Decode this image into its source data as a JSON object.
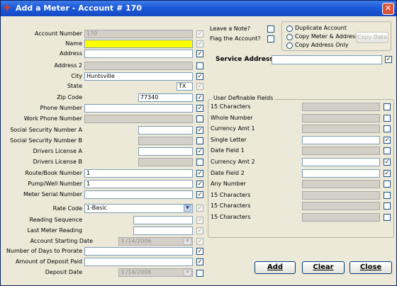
{
  "window": {
    "title": "Add a Meter - Account # 170",
    "close_glyph": "✕",
    "icon": "meter-app-icon"
  },
  "left": {
    "account_number": {
      "label": "Account Number",
      "value": "170"
    },
    "name": {
      "label": "Name",
      "value": ""
    },
    "address": {
      "label": "Address",
      "value": ""
    },
    "address2": {
      "label": "Address 2",
      "value": ""
    },
    "city": {
      "label": "City",
      "value": "Huntsville"
    },
    "state": {
      "label": "State",
      "value": "TX"
    },
    "zip": {
      "label": "Zip Code",
      "value": "77340"
    },
    "phone": {
      "label": "Phone Number",
      "value": ""
    },
    "work_phone": {
      "label": "Work Phone Number",
      "value": ""
    },
    "ssn_a": {
      "label": "Social Security Number A",
      "value": ""
    },
    "ssn_b": {
      "label": "Social Security Number B",
      "value": ""
    },
    "dl_a": {
      "label": "Drivers License A",
      "value": ""
    },
    "dl_b": {
      "label": "Drivers License B",
      "value": ""
    },
    "route": {
      "label": "Route/Book Number",
      "value": "1"
    },
    "pump": {
      "label": "Pump/Well Number",
      "value": "1"
    },
    "serial": {
      "label": "Meter Serial Number",
      "value": ""
    },
    "rate": {
      "label": "Rate Code",
      "value": "1-Basic"
    },
    "reading_seq": {
      "label": "Reading Sequence",
      "value": ""
    },
    "last_reading": {
      "label": "Last Meter Reading",
      "value": ""
    },
    "start_date": {
      "label": "Account Starting Date",
      "value": "3 /14/2006"
    },
    "prorate": {
      "label": "Number of Days to Prorate",
      "value": ""
    },
    "deposit_paid": {
      "label": "Amount of Deposit Paid",
      "value": ""
    },
    "deposit_date": {
      "label": "Deposit Date",
      "value": "3 /14/2006"
    }
  },
  "right": {
    "leave_note": "Leave a Note?",
    "flag_account": "Flag the Account?",
    "options": [
      "Duplicate Account",
      "Copy Meter & Address",
      "Copy Address Only"
    ],
    "copy_data": "Copy Data",
    "service_address_label": "Service Address",
    "service_address_value": "",
    "udf_title": "User Definable Fields",
    "udf": [
      {
        "label": "15 Characters",
        "checked": false,
        "enabled": false
      },
      {
        "label": "Whole Number",
        "checked": false,
        "enabled": false
      },
      {
        "label": "Currency Amt 1",
        "checked": false,
        "enabled": false
      },
      {
        "label": "Single Letter",
        "checked": true,
        "enabled": true
      },
      {
        "label": "Date Field 1",
        "checked": false,
        "enabled": false
      },
      {
        "label": "Currency Amt 2",
        "checked": true,
        "enabled": true
      },
      {
        "label": "Date Field 2",
        "checked": true,
        "enabled": true
      },
      {
        "label": "Any Number",
        "checked": false,
        "enabled": false
      },
      {
        "label": "15 Characters",
        "checked": false,
        "enabled": false
      },
      {
        "label": "15 Characters",
        "checked": false,
        "enabled": false
      },
      {
        "label": "15 Characters",
        "checked": false,
        "enabled": false
      }
    ]
  },
  "buttons": {
    "add": "Add",
    "clear": "Clear",
    "close": "Close"
  },
  "check_glyph": "✓",
  "dropdown_glyph": "▼"
}
